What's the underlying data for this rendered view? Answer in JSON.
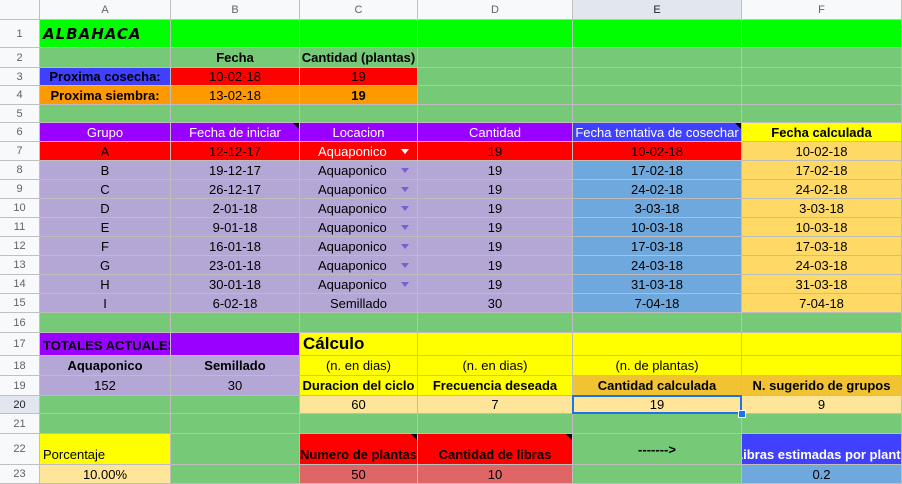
{
  "columns": [
    "A",
    "B",
    "C",
    "D",
    "E",
    "F"
  ],
  "rows": [
    "1",
    "2",
    "3",
    "4",
    "5",
    "6",
    "7",
    "8",
    "9",
    "10",
    "11",
    "12",
    "13",
    "14",
    "15",
    "16",
    "17",
    "18",
    "19",
    "20",
    "21",
    "22",
    "23"
  ],
  "colors": {
    "green": "#76c976",
    "bright_green": "#00ff00",
    "blue": "#4040ff",
    "red": "#ff0000",
    "orange": "#ff9900",
    "purple": "#9900ff",
    "lavender": "#b4a7d6",
    "sky": "#6fa8dc",
    "gold": "#ffd966",
    "yellow": "#ffff00",
    "dark_orange": "#f1c232",
    "salmon": "#e06666",
    "pale_yellow": "#ffe599",
    "selection": "#1a73e8"
  },
  "sheet": {
    "title": "ALBAHACA",
    "fecha_label": "Fecha",
    "cantidad_plantas_label": "Cantidad (plantas)",
    "proxima_cosecha_label": "Proxima cosecha:",
    "proxima_cosecha_fecha": "10-02-18",
    "proxima_cosecha_cantidad": "19",
    "proxima_siembra_label": "Proxima siembra:",
    "proxima_siembra_fecha": "13-02-18",
    "proxima_siembra_cantidad": "19",
    "table_headers": [
      "Grupo",
      "Fecha de iniciar",
      "Locacion",
      "Cantidad",
      "Fecha tentativa de cosechar",
      "Fecha calculada"
    ],
    "groups": [
      {
        "grupo": "A",
        "inicio": "12-12-17",
        "locacion": "Aquaponico",
        "cantidad": "19",
        "tentativa": "10-02-18",
        "calculada": "10-02-18"
      },
      {
        "grupo": "B",
        "inicio": "19-12-17",
        "locacion": "Aquaponico",
        "cantidad": "19",
        "tentativa": "17-02-18",
        "calculada": "17-02-18"
      },
      {
        "grupo": "C",
        "inicio": "26-12-17",
        "locacion": "Aquaponico",
        "cantidad": "19",
        "tentativa": "24-02-18",
        "calculada": "24-02-18"
      },
      {
        "grupo": "D",
        "inicio": "2-01-18",
        "locacion": "Aquaponico",
        "cantidad": "19",
        "tentativa": "3-03-18",
        "calculada": "3-03-18"
      },
      {
        "grupo": "E",
        "inicio": "9-01-18",
        "locacion": "Aquaponico",
        "cantidad": "19",
        "tentativa": "10-03-18",
        "calculada": "10-03-18"
      },
      {
        "grupo": "F",
        "inicio": "16-01-18",
        "locacion": "Aquaponico",
        "cantidad": "19",
        "tentativa": "17-03-18",
        "calculada": "17-03-18"
      },
      {
        "grupo": "G",
        "inicio": "23-01-18",
        "locacion": "Aquaponico",
        "cantidad": "19",
        "tentativa": "24-03-18",
        "calculada": "24-03-18"
      },
      {
        "grupo": "H",
        "inicio": "30-01-18",
        "locacion": "Aquaponico",
        "cantidad": "19",
        "tentativa": "31-03-18",
        "calculada": "31-03-18"
      },
      {
        "grupo": "I",
        "inicio": "6-02-18",
        "locacion": "Semillado",
        "cantidad": "30",
        "tentativa": "7-04-18",
        "calculada": "7-04-18"
      }
    ],
    "totales_label": "TOTALES ACTUALES",
    "calculo_label": "Cálculo",
    "n_dias_1": "(n. en dias)",
    "n_dias_2": "(n. en dias)",
    "n_plantas": "(n. de plantas)",
    "aquaponico_label": "Aquaponico",
    "semillado_label": "Semillado",
    "duracion_label": "Duracion del ciclo",
    "frecuencia_label": "Frecuencia deseada",
    "cantidad_calc_label": "Cantidad calculada",
    "sugerido_label": "N. sugerido de grupos",
    "aquaponico_total": "152",
    "semillado_total": "30",
    "duracion_value": "60",
    "frecuencia_value": "7",
    "cantidad_calc_value": "19",
    "sugerido_value": "9",
    "porcentaje_label": "Porcentaje",
    "porcentaje_value": "10.00%",
    "numero_plantas_label": "Numero de plantas",
    "cantidad_libras_label": "Cantidad de libras",
    "arrow_text": "------->",
    "libras_estimadas_label": "Libras estimadas por planta",
    "numero_plantas_value": "50",
    "cantidad_libras_value": "10",
    "libras_estimadas_value": "0.2"
  }
}
